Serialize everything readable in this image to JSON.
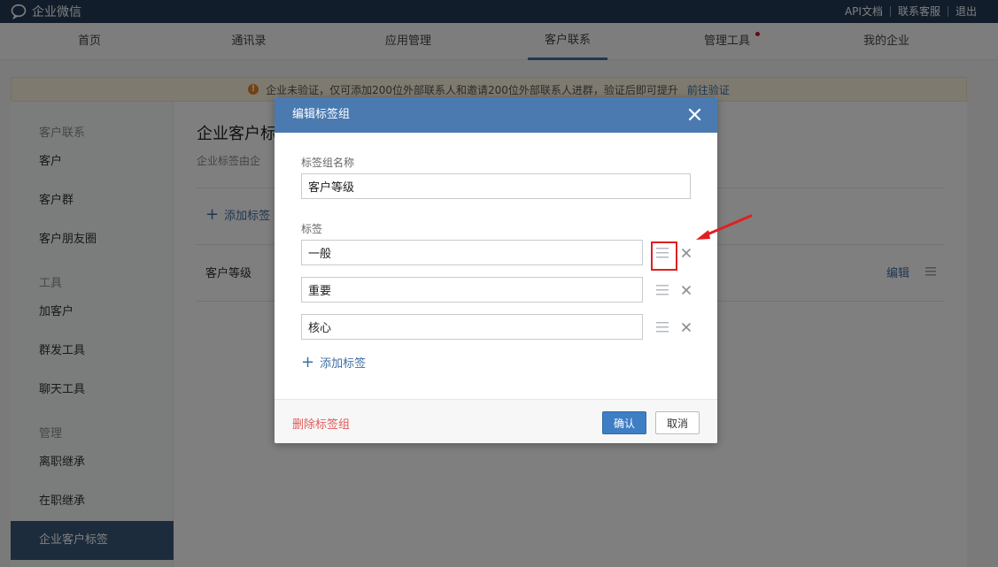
{
  "topbar": {
    "logo_text": "企业微信",
    "links": [
      "API文档",
      "联系客服",
      "退出"
    ]
  },
  "nav": {
    "items": [
      {
        "label": "首页"
      },
      {
        "label": "通讯录"
      },
      {
        "label": "应用管理"
      },
      {
        "label": "客户联系",
        "active": true
      },
      {
        "label": "管理工具",
        "dot": true
      },
      {
        "label": "我的企业"
      }
    ]
  },
  "notice": {
    "text": "企业未验证，仅可添加200位外部联系人和邀请200位外部联系人进群，验证后即可提升",
    "link": "前往验证"
  },
  "sidebar": {
    "group1": "客户联系",
    "items1": [
      "客户",
      "客户群",
      "客户朋友圈"
    ],
    "group2": "工具",
    "items2": [
      "加客户",
      "群发工具",
      "聊天工具"
    ],
    "group3": "管理",
    "items3": [
      "离职继承",
      "在职继承",
      "企业客户标签"
    ],
    "active": "企业客户标签"
  },
  "main": {
    "title": "企业客户标",
    "desc": "企业标签由企",
    "add_tag": "添加标签",
    "group_name": "客户等级",
    "edit": "编辑"
  },
  "modal": {
    "title": "编辑标签组",
    "group_name_label": "标签组名称",
    "group_name_value": "客户等级",
    "tags_label": "标签",
    "tags": [
      "一般",
      "重要",
      "核心"
    ],
    "add_tag": "添加标签",
    "delete_group": "删除标签组",
    "confirm": "确认",
    "cancel": "取消"
  },
  "colors": {
    "topbar": "#243b57",
    "accent": "#4a7ab0",
    "active_nav": "#3a597a",
    "danger": "#e05b5b",
    "annotation": "#e02020"
  }
}
